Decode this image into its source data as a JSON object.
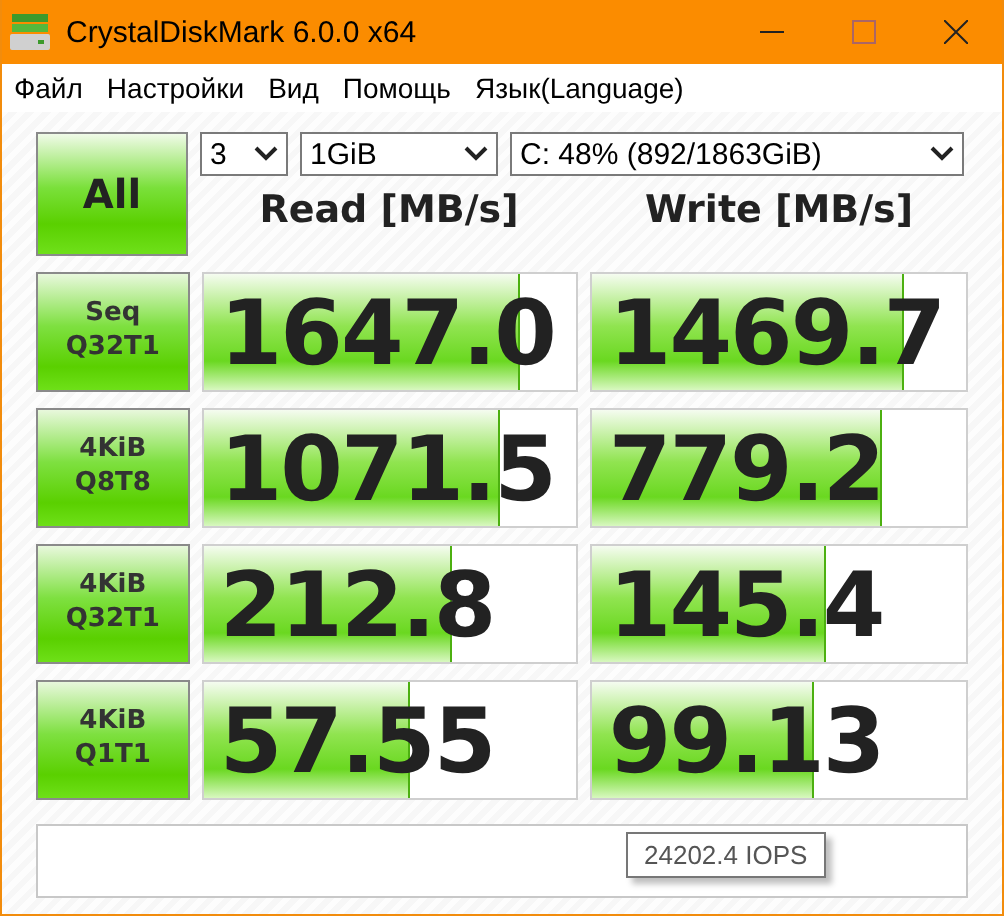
{
  "window": {
    "title": "CrystalDiskMark 6.0.0 x64"
  },
  "menu": [
    "Файл",
    "Настройки",
    "Вид",
    "Помощь",
    "Язык(Language)"
  ],
  "all_button": "All",
  "selects": [
    {
      "value": "3"
    },
    {
      "value": "1GiB"
    },
    {
      "value": "C: 48% (892/1863GiB)"
    }
  ],
  "headers": [
    "Read [MB/s]",
    "Write [MB/s]"
  ],
  "rows": [
    {
      "label": "Seq\nQ32T1",
      "read": {
        "value": "1647.0",
        "level": 0.84
      },
      "write": {
        "value": "1469.7",
        "level": 0.83
      }
    },
    {
      "label": "4KiB\nQ8T8",
      "read": {
        "value": "1071.5",
        "level": 0.79
      },
      "write": {
        "value": "779.2",
        "level": 0.77
      }
    },
    {
      "label": "4KiB\nQ32T1",
      "read": {
        "value": "212.8",
        "level": 0.66
      },
      "write": {
        "value": "145.4",
        "level": 0.62
      }
    },
    {
      "label": "4KiB\nQ1T1",
      "read": {
        "value": "57.55",
        "level": 0.55
      },
      "write": {
        "value": "99.13",
        "level": 0.59
      }
    }
  ],
  "tooltip": "24202.4 IOPS"
}
